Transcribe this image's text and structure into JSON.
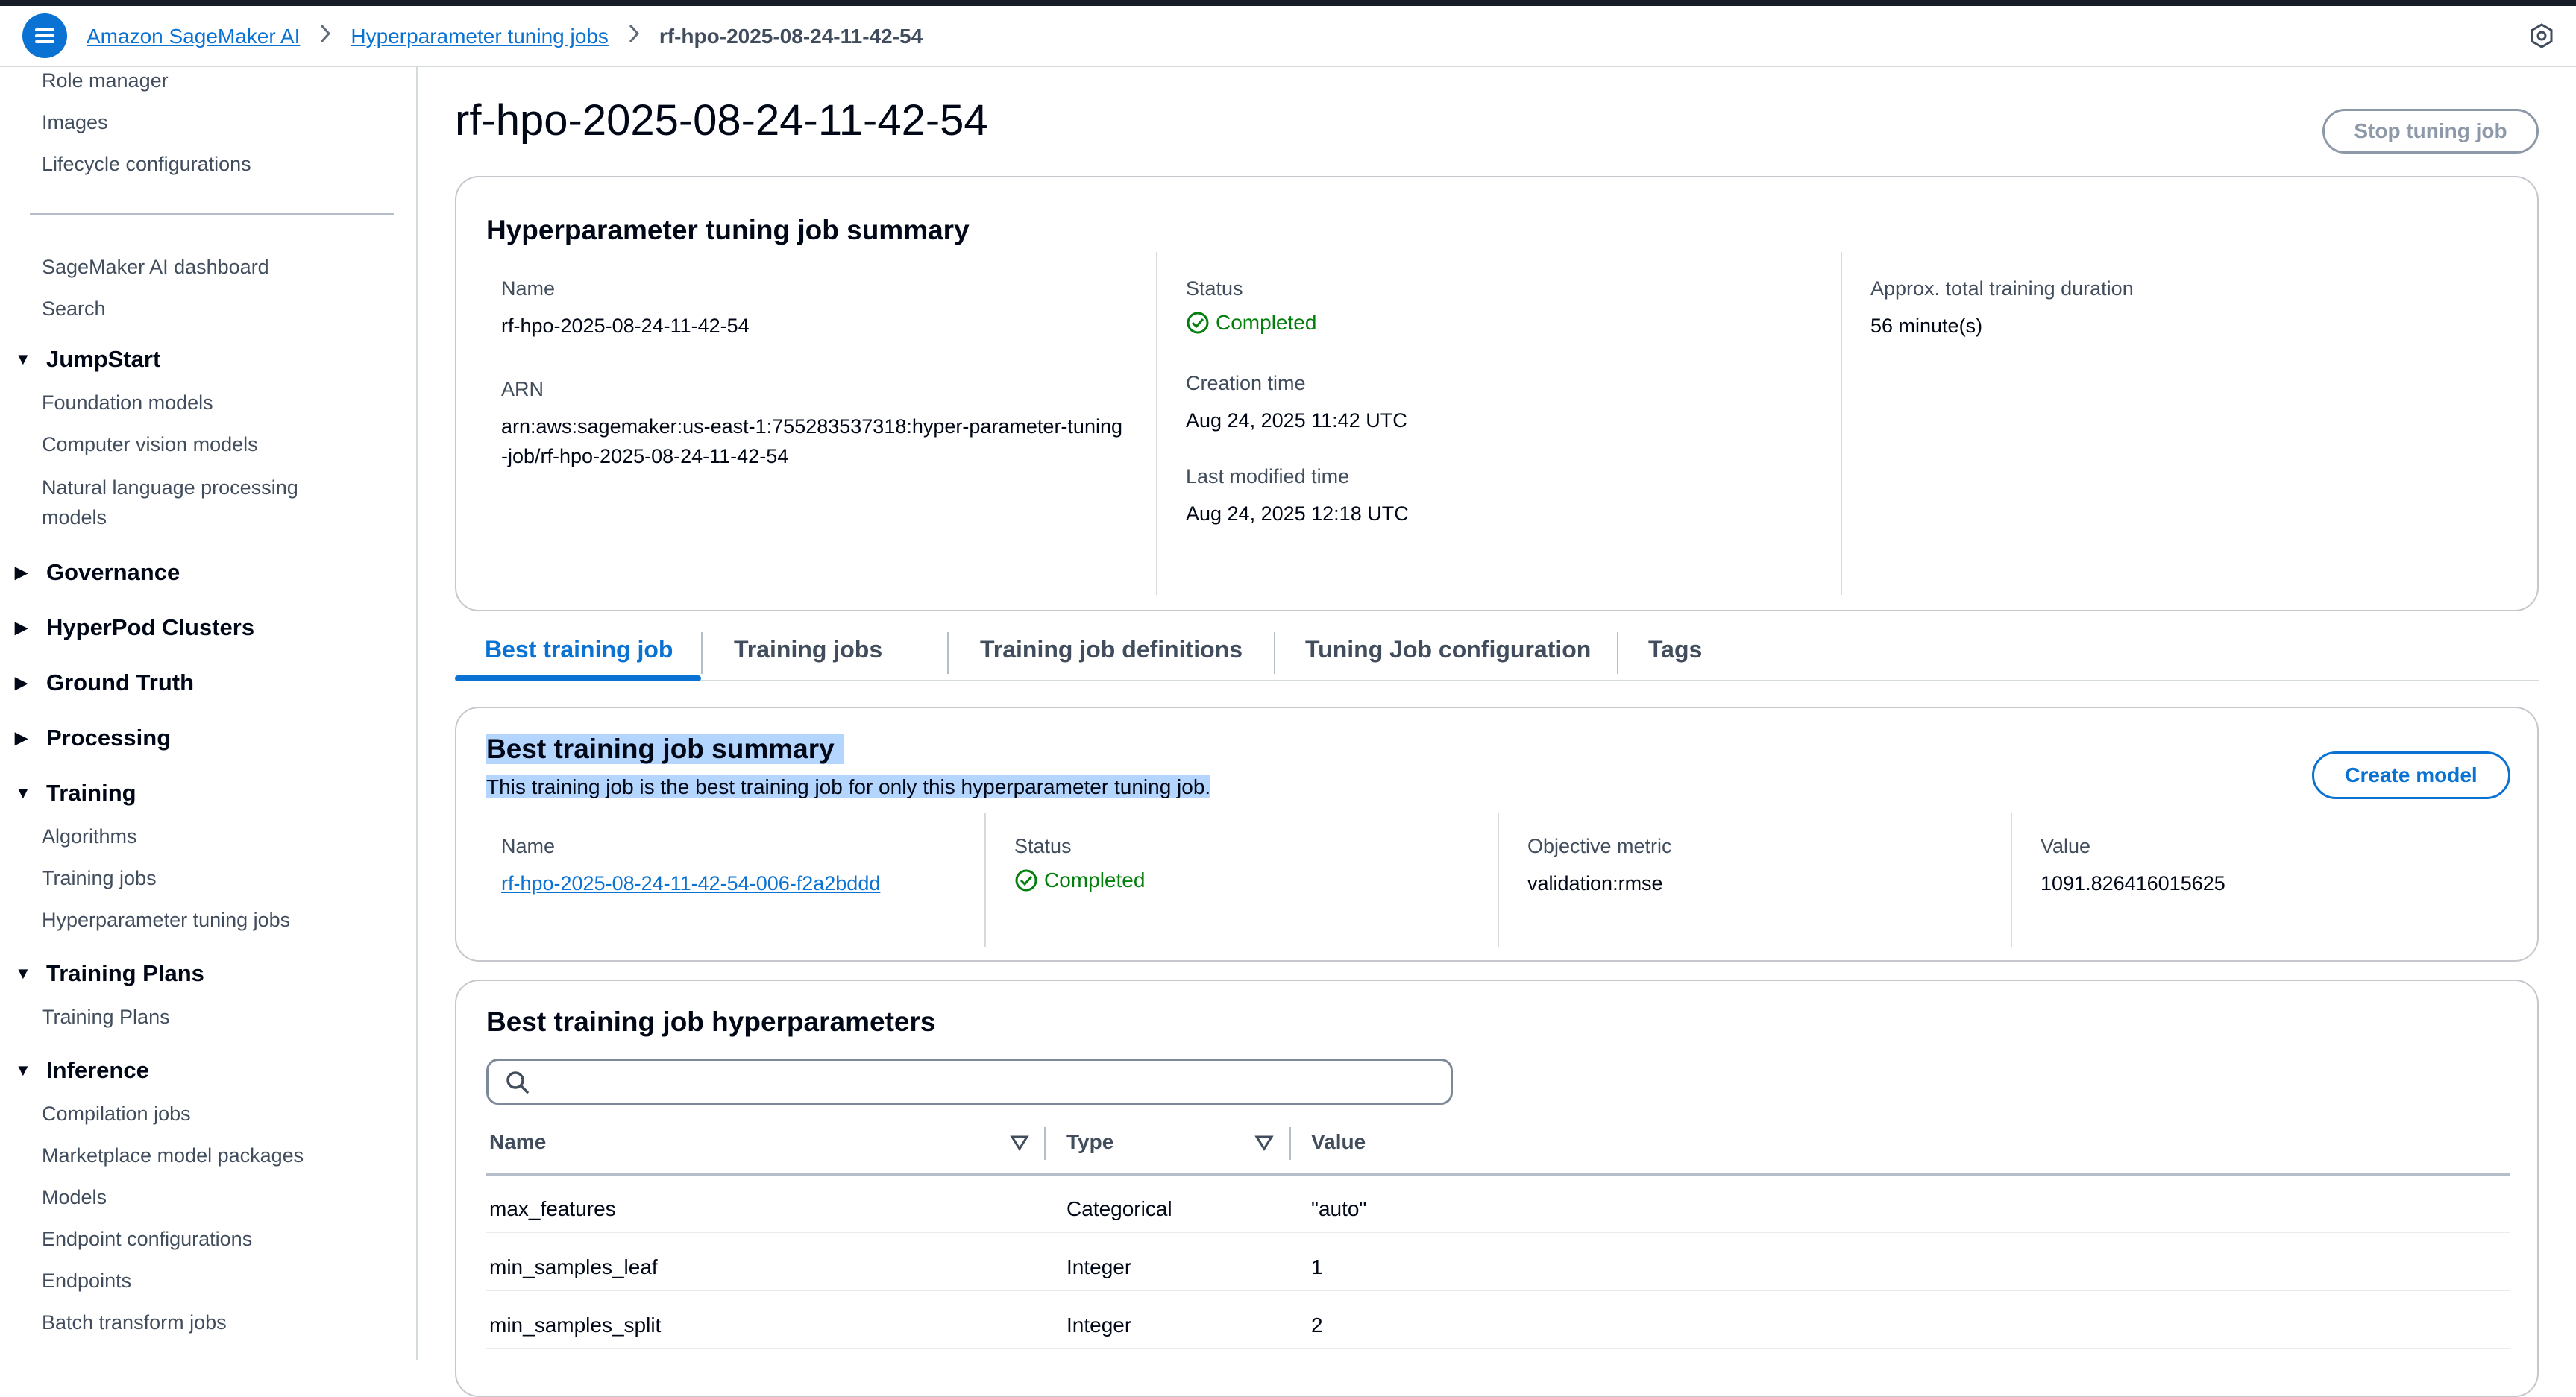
{
  "header": {
    "breadcrumbs": [
      "Amazon SageMaker AI",
      "Hyperparameter tuning jobs",
      "rf-hpo-2025-08-24-11-42-54"
    ]
  },
  "sidebar": {
    "top_items": [
      "Role manager",
      "Images",
      "Lifecycle configurations"
    ],
    "mid_items": [
      "SageMaker AI dashboard",
      "Search"
    ],
    "sections": [
      {
        "label": "JumpStart",
        "expanded": true,
        "items": [
          "Foundation models",
          "Computer vision models",
          "Natural language processing models"
        ]
      },
      {
        "label": "Governance",
        "expanded": false,
        "items": []
      },
      {
        "label": "HyperPod Clusters",
        "expanded": false,
        "items": []
      },
      {
        "label": "Ground Truth",
        "expanded": false,
        "items": []
      },
      {
        "label": "Processing",
        "expanded": false,
        "items": []
      },
      {
        "label": "Training",
        "expanded": true,
        "items": [
          "Algorithms",
          "Training jobs",
          "Hyperparameter tuning jobs"
        ]
      },
      {
        "label": "Training Plans",
        "expanded": true,
        "items": [
          "Training Plans"
        ]
      },
      {
        "label": "Inference",
        "expanded": true,
        "items": [
          "Compilation jobs",
          "Marketplace model packages",
          "Models",
          "Endpoint configurations",
          "Endpoints",
          "Batch transform jobs"
        ]
      }
    ]
  },
  "page": {
    "title": "rf-hpo-2025-08-24-11-42-54",
    "stop_button": "Stop tuning job"
  },
  "summary": {
    "title": "Hyperparameter tuning job summary",
    "name_label": "Name",
    "name_value": "rf-hpo-2025-08-24-11-42-54",
    "arn_label": "ARN",
    "arn_value": "arn:aws:sagemaker:us-east-1:755283537318:hyper-parameter-tuning-job/rf-hpo-2025-08-24-11-42-54",
    "status_label": "Status",
    "status_value": "Completed",
    "creation_label": "Creation time",
    "creation_value": "Aug 24, 2025 11:42 UTC",
    "modified_label": "Last modified time",
    "modified_value": "Aug 24, 2025 12:18 UTC",
    "duration_label": "Approx. total training duration",
    "duration_value": "56 minute(s)"
  },
  "tabs": [
    "Best training job",
    "Training jobs",
    "Training job definitions",
    "Tuning Job configuration",
    "Tags"
  ],
  "best_job": {
    "title": "Best training job summary",
    "description": "This training job is the best training job for only this hyperparameter tuning job.",
    "create_button": "Create model",
    "name_label": "Name",
    "name_value": "rf-hpo-2025-08-24-11-42-54-006-f2a2bddd",
    "status_label": "Status",
    "status_value": "Completed",
    "metric_label": "Objective metric",
    "metric_value": "validation:rmse",
    "value_label": "Value",
    "value_value": "1091.826416015625"
  },
  "hyperparams": {
    "title": "Best training job hyperparameters",
    "search_placeholder": "",
    "columns": [
      "Name",
      "Type",
      "Value"
    ],
    "rows": [
      {
        "name": "max_features",
        "type": "Categorical",
        "value": "\"auto\""
      },
      {
        "name": "min_samples_leaf",
        "type": "Integer",
        "value": "1"
      },
      {
        "name": "min_samples_split",
        "type": "Integer",
        "value": "2"
      }
    ]
  },
  "colors": {
    "accent": "#0972d3",
    "success": "#037f0c",
    "highlight": "#b4d5fe"
  }
}
